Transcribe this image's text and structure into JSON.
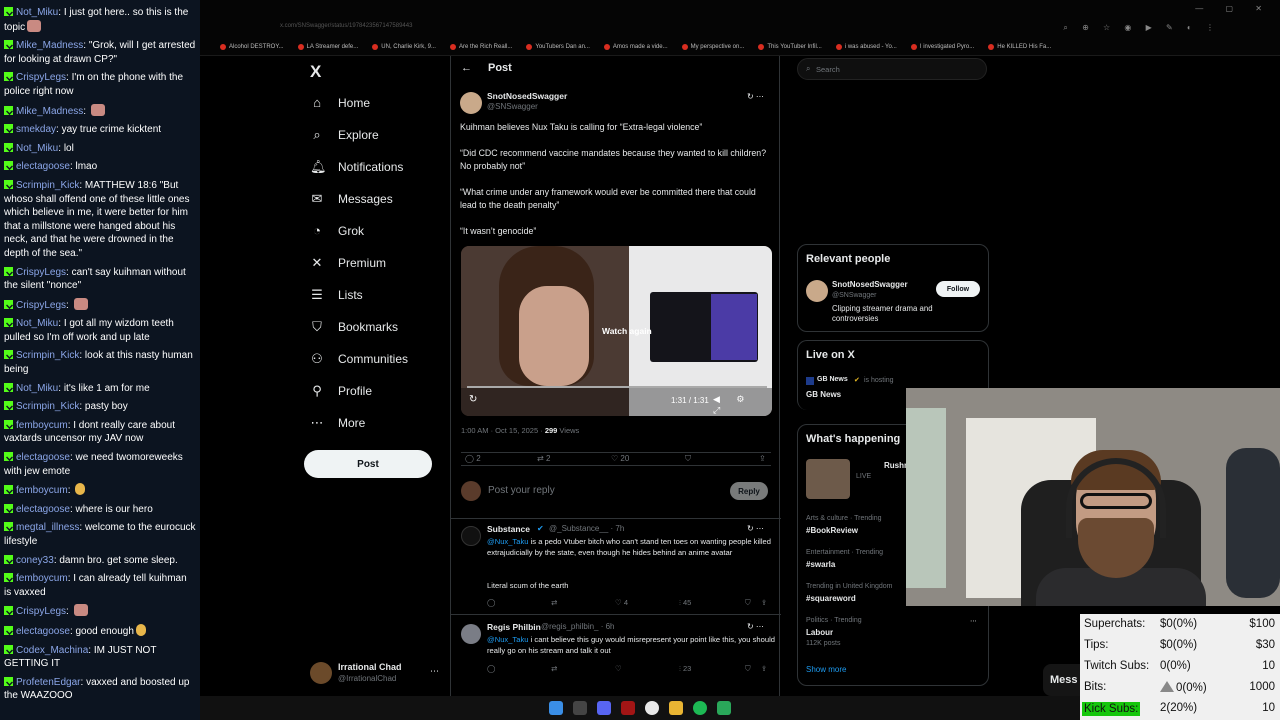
{
  "chat": [
    {
      "user": "Not_Miku",
      "text": "I just got here.. so this is the topic",
      "emote": true
    },
    {
      "user": "Mike_Madness",
      "text": "\"Grok, will I get arrested for looking at drawn CP?\""
    },
    {
      "user": "CrispyLegs",
      "text": "I'm on the phone with the police right now"
    },
    {
      "user": "Mike_Madness",
      "text": "",
      "emote": true
    },
    {
      "user": "smekday",
      "text": "yay true crime kicktent"
    },
    {
      "user": "Not_Miku",
      "text": "lol"
    },
    {
      "user": "electagoose",
      "text": "lmao"
    },
    {
      "user": "Scrimpin_Kick",
      "text": "MATTHEW 18:6 \"But whoso shall offend one of these little ones which believe in me, it were better for him that a millstone were hanged about his neck, and that he were drowned in the depth of the sea.\""
    },
    {
      "user": "CrispyLegs",
      "text": "can't say kuihman without the silent \"nonce\""
    },
    {
      "user": "CrispyLegs",
      "text": "",
      "emote": true
    },
    {
      "user": "Not_Miku",
      "text": "I got all my wizdom teeth pulled so I'm off work and up late"
    },
    {
      "user": "Scrimpin_Kick",
      "text": "look at this nasty human being"
    },
    {
      "user": "Not_Miku",
      "text": "it's like 1 am for me"
    },
    {
      "user": "Scrimpin_Kick",
      "text": "pasty boy"
    },
    {
      "user": "femboycum",
      "text": "I dont really care about vaxtards uncensor my JAV now"
    },
    {
      "user": "electagoose",
      "text": "we need twomoreweeks with jew emote"
    },
    {
      "user": "femboycum",
      "text": "",
      "emote": true
    },
    {
      "user": "electagoose",
      "text": "where is our hero"
    },
    {
      "user": "megtal_illness",
      "text": "welcome to the eurocuck lifestyle"
    },
    {
      "user": "coney33",
      "text": "damn bro. get some sleep."
    },
    {
      "user": "femboycum",
      "text": "I can already tell kuihman is vaxxed"
    },
    {
      "user": "CrispyLegs",
      "text": "",
      "emote": true
    },
    {
      "user": "electagoose",
      "text": "good enough",
      "emote": true
    },
    {
      "user": "Codex_Machina",
      "text": "IM JUST NOT GETTING IT"
    },
    {
      "user": "ProfetenEdgar",
      "text": "vaxxed and boosted up the WAAZOOO"
    }
  ],
  "browser": {
    "url": "x.com/SNSwagger/status/1978423567147589443",
    "bookmarks": [
      "Alcohol DESTROY...",
      "LA Streamer defe...",
      "UN, Charlie Kirk, 9...",
      "Are the Rich Reall...",
      "YouTubers Dan an...",
      "Amos made a vide...",
      "My perspective on...",
      "This YouTuber Infil...",
      "i was abused - Yo...",
      "I investigated Pyro...",
      "He KILLED His Fa..."
    ]
  },
  "nav": {
    "logo": "X",
    "items": [
      "Home",
      "Explore",
      "Notifications",
      "Messages",
      "Grok",
      "Premium",
      "Lists",
      "Bookmarks",
      "Communities",
      "Profile",
      "More"
    ],
    "post_button": "Post",
    "account_name": "Irrational Chad",
    "account_handle": "@IrrationalChad"
  },
  "post": {
    "header": "Post",
    "author": "SnotNosedSwagger",
    "handle": "@SNSwagger",
    "paragraphs": [
      "Kuihman believes Nux Taku is calling for “Extra-legal violence”",
      "“Did CDC recommend vaccine mandates because they wanted to kill children? No probably not”",
      "“What crime under any framework would ever be committed there that could lead to the death penalty”",
      "“It wasn’t genocide”"
    ],
    "media_overlay": "Watch again",
    "media_time": "1:31 / 1:31",
    "time": "1:00 AM · Oct 15, 2025 ·",
    "views_count": "299",
    "views_label": "Views",
    "replies": "2",
    "reposts": "2",
    "likes": "20",
    "reply_placeholder": "Post your reply",
    "reply_button": "Reply"
  },
  "replies": [
    {
      "name": "Substance",
      "handle": "@_Substance__ · 7h",
      "mention": "@Nux_Taku",
      "text": " is a pedo Vtuber bitch who can't stand ten toes on wanting people killed extrajudicially by the state, even though he hides behind an anime avatar",
      "text2": "Literal scum of the earth",
      "likes": "4",
      "views": "45"
    },
    {
      "name": "Regis Philbin",
      "handle": "@regis_philbin_ · 6h",
      "mention": "@Nux_Taku",
      "text": " i cant believe this guy would misrepresent your point like this, you should really go on his stream and talk it out",
      "text2": "",
      "likes": "",
      "views": "23"
    }
  ],
  "sidebar": {
    "search_placeholder": "Search",
    "relevant_title": "Relevant people",
    "person_name": "SnotNosedSwagger",
    "person_handle": "@SNSwagger",
    "person_bio": "Clipping streamer drama and controversies",
    "follow": "Follow",
    "live_title": "Live on X",
    "live_host": "GB News",
    "live_status": "is hosting",
    "live_show": "GB News",
    "happening_title": "What's happening",
    "happening_feature": "Rushmore",
    "happening_feature_sub": "LIVE",
    "trends": [
      {
        "context": "Arts & culture · Trending",
        "name": "#BookReview",
        "posts": ""
      },
      {
        "context": "Entertainment · Trending",
        "name": "#swarla",
        "posts": ""
      },
      {
        "context": "Trending in United Kingdom",
        "name": "#squareword",
        "posts": ""
      },
      {
        "context": "Politics · Trending",
        "name": "Labour",
        "posts": "112K posts"
      }
    ],
    "show_more": "Show more"
  },
  "messages_tab": "Mess",
  "stats": [
    {
      "label": "Superchats:",
      "value": "$0(0%)",
      "goal": "$100"
    },
    {
      "label": "Tips:",
      "value": "$0(0%)",
      "goal": "$30"
    },
    {
      "label": "Twitch Subs:",
      "value": "0(0%)",
      "goal": "10"
    },
    {
      "label": "Bits:",
      "value": "0(0%)",
      "goal": "1000"
    },
    {
      "label": "Kick Subs:",
      "value": "2(20%)",
      "goal": "10"
    }
  ],
  "colors": {
    "accent": "#1d9bf0",
    "kick_green": "#53fc18",
    "bg": "#000000"
  }
}
